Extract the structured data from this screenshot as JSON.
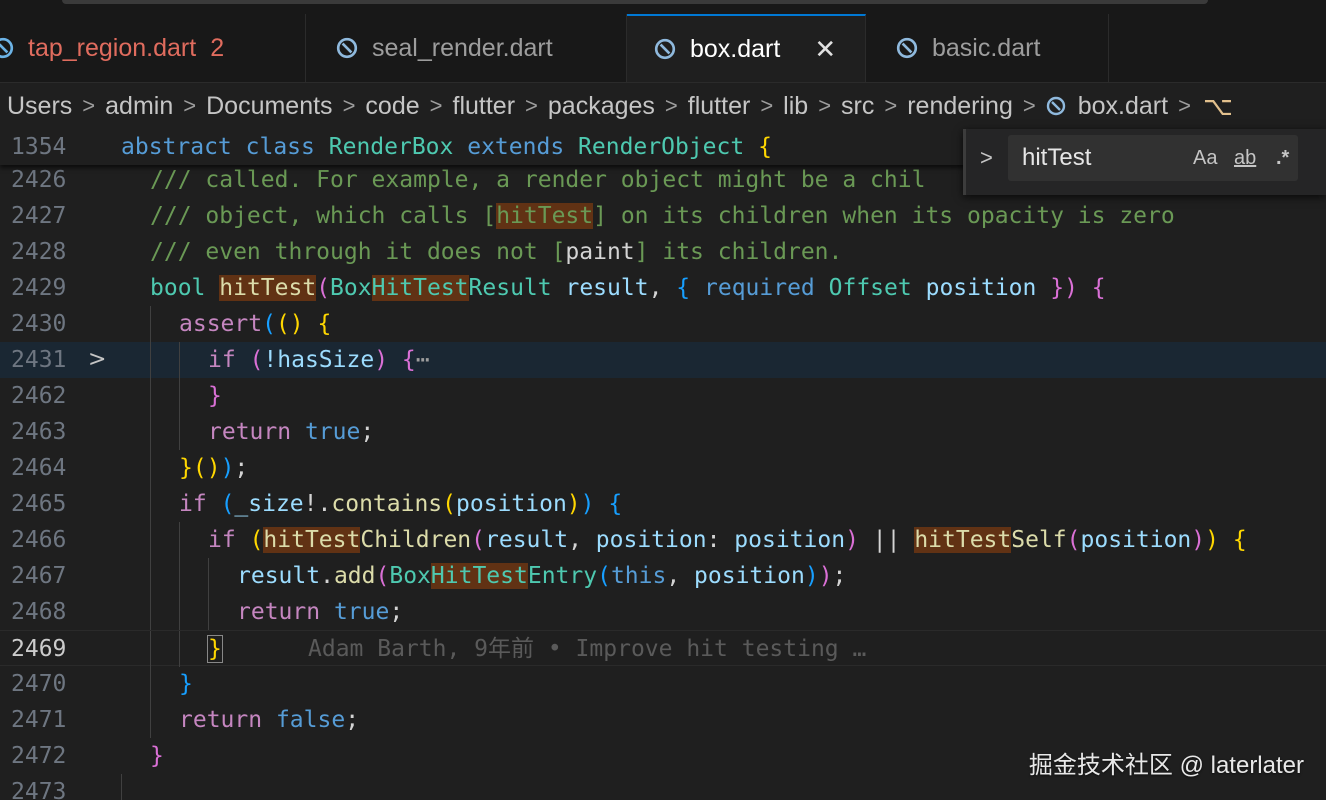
{
  "tabs": [
    {
      "label": "tap_region.dart",
      "badge": "2",
      "state": "warning"
    },
    {
      "label": "seal_render.dart",
      "state": "normal"
    },
    {
      "label": "box.dart",
      "state": "active",
      "close": "✕"
    },
    {
      "label": "basic.dart",
      "state": "normal"
    }
  ],
  "breadcrumb": [
    "Users",
    "admin",
    "Documents",
    "code",
    "flutter",
    "packages",
    "flutter",
    "lib",
    "src",
    "rendering",
    "box.dart"
  ],
  "breadcrumb_separator": ">",
  "find": {
    "toggle": ">",
    "query": "hitTest",
    "match_case": "Aa",
    "whole_word": "ab",
    "regex": ".*"
  },
  "sticky": {
    "number": "1354",
    "t1": "abstract",
    "t2": "class",
    "t3": "RenderBox",
    "t4": "extends",
    "t5": "RenderObject",
    "t6": "{"
  },
  "lines": {
    "l2426": {
      "n": "2426",
      "t1": "/// called. For example, a render object might be a chil"
    },
    "l2427": {
      "n": "2427",
      "t1": "/// object, which calls [",
      "t2": "hitTest",
      "t3": "] on its children when its opacity is zero"
    },
    "l2428": {
      "n": "2428",
      "t1": "/// even through it does not [",
      "t2": "paint",
      "t3": "] its children."
    },
    "l2429": {
      "n": "2429",
      "t1": "bool",
      "t2": "hitTest",
      "t3": "(",
      "t4": "Box",
      "t5": "HitTest",
      "t6": "Result",
      "t7": "result",
      "t8": ", ",
      "t9": "{",
      "t10": "required",
      "t11": "Offset",
      "t12": "position",
      "t13": "})",
      "t14": "{"
    },
    "l2430": {
      "n": "2430",
      "t1": "assert",
      "t2": "(",
      "t3": "()",
      "t4": "{"
    },
    "l2431": {
      "n": "2431",
      "fold": ">",
      "t1": "if",
      "t2": "(",
      "t3": "!hasSize",
      "t4": ")",
      "t5": "{",
      "t6": "⋯"
    },
    "l2462": {
      "n": "2462",
      "t1": "}"
    },
    "l2463": {
      "n": "2463",
      "t1": "return",
      "t2": "true",
      "t3": ";"
    },
    "l2464": {
      "n": "2464",
      "t1": "}",
      "t2": "()",
      "t3": ")",
      "t4": ";"
    },
    "l2465": {
      "n": "2465",
      "t1": "if",
      "t2": "(",
      "t3": "_size",
      "t4": "!.",
      "t5": "contains",
      "t6": "(",
      "t7": "position",
      "t8": ")",
      "t9": ")",
      "t10": "{"
    },
    "l2466": {
      "n": "2466",
      "t1": "if",
      "t2": "(",
      "t3": "hitTest",
      "t4": "Children",
      "t5": "(",
      "t6": "result",
      "t7": ", ",
      "t8": "position",
      "t9": ": ",
      "t10": "position",
      "t11": ")",
      "t12": " || ",
      "t13": "hitTest",
      "t14": "Self",
      "t15": "(",
      "t16": "position",
      "t17": ")",
      "t18": ")",
      "t19": "{"
    },
    "l2467": {
      "n": "2467",
      "t1": "result",
      "t2": ".",
      "t3": "add",
      "t4": "(",
      "t5": "Box",
      "t6": "HitTest",
      "t7": "Entry",
      "t8": "(",
      "t9": "this",
      "t10": ", ",
      "t11": "position",
      "t12": ")",
      "t13": ")",
      "t14": ";"
    },
    "l2468": {
      "n": "2468",
      "t1": "return",
      "t2": "true",
      "t3": ";"
    },
    "l2469": {
      "n": "2469",
      "t1": "}",
      "blame": "Adam Barth, 9年前 • Improve hit testing …"
    },
    "l2470": {
      "n": "2470",
      "t1": "}"
    },
    "l2471": {
      "n": "2471",
      "t1": "return",
      "t2": "false",
      "t3": ";"
    },
    "l2472": {
      "n": "2472",
      "t1": "}"
    },
    "l2473": {
      "n": "2473"
    }
  },
  "watermark": "掘金技术社区 @ laterlater",
  "colors": {
    "accent": "#0078d4",
    "match": "#613214",
    "warning": "#e06c5e"
  }
}
